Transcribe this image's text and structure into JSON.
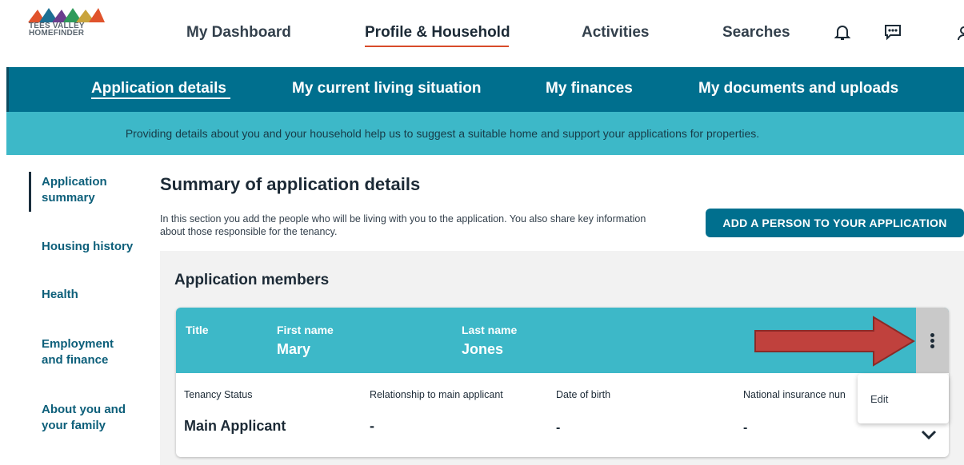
{
  "brand": {
    "line1": "TEES VALLEY",
    "line2": "HOMEFINDER"
  },
  "top_nav": {
    "items": [
      {
        "label": "My Dashboard"
      },
      {
        "label": "Profile & Household"
      },
      {
        "label": "Activities"
      },
      {
        "label": "Searches"
      }
    ],
    "icons": [
      "bell-icon",
      "chat-icon",
      "user-icon"
    ]
  },
  "sub_nav": {
    "items": [
      {
        "label": "Application details"
      },
      {
        "label": "My current living situation"
      },
      {
        "label": "My finances"
      },
      {
        "label": "My documents and uploads"
      }
    ]
  },
  "banner": {
    "text": "Providing details about you and your household help us to suggest a suitable home and support your applications for properties."
  },
  "sidebar": {
    "items": [
      {
        "label": "Application summary"
      },
      {
        "label": "Housing history"
      },
      {
        "label": "Health"
      },
      {
        "label": "Employment and finance"
      },
      {
        "label": "About you and your family"
      }
    ]
  },
  "main": {
    "title": "Summary of application details",
    "intro": "In this section you add the people who will be living with you to the application. You also share key information about those responsible for the tenancy.",
    "add_button": "ADD A PERSON TO YOUR APPLICATION",
    "members_title": "Application members",
    "member": {
      "title_label": "Title",
      "first_name_label": "First name",
      "first_name": "Mary",
      "last_name_label": "Last name",
      "last_name": "Jones",
      "tenancy_status_label": "Tenancy Status",
      "tenancy_status": "Main Applicant",
      "relationship_label": "Relationship to main applicant",
      "relationship": "-",
      "dob_label": "Date of birth",
      "dob": "-",
      "ni_label": "National insurance nun",
      "ni": "-"
    },
    "menu": {
      "items": [
        {
          "label": "Edit"
        }
      ]
    }
  },
  "colors": {
    "primary": "#006f8e",
    "banner": "#3db8c8",
    "accent_underline": "#d84b2a",
    "annotation_arrow": "#c0413d"
  }
}
